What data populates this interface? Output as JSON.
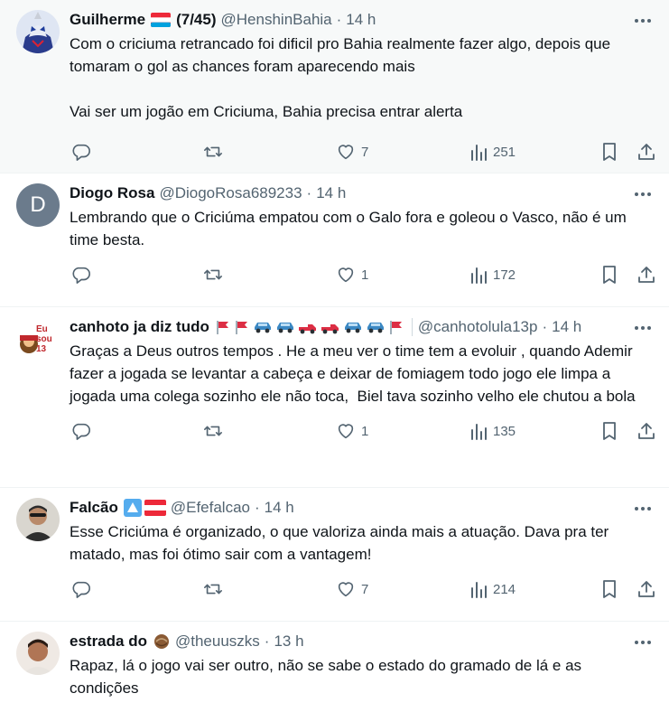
{
  "tweets": [
    {
      "name": "Guilherme",
      "name_suffix": "(7/45)",
      "handle": "@HenshinBahia",
      "time": "14 h",
      "text": "Com o criciuma retrancado foi dificil pro Bahia realmente fazer algo, depois que tomaram o gol as chances foram aparecendo mais\n\nVai ser um jogão em Criciuma, Bahia precisa entrar alerta",
      "likes": "7",
      "views": "251",
      "avatar_icon": "robot-hero-avatar",
      "highlighted": true
    },
    {
      "name": "Diogo Rosa",
      "handle": "@DiogoRosa689233",
      "time": "14 h",
      "text": "Lembrando que o Criciúma empatou com o Galo fora e goleou o Vasco, não é um time besta.",
      "likes": "1",
      "views": "172",
      "avatar_letter": "D",
      "avatar_color": "#5b7083"
    },
    {
      "name": "canhoto ja diz tudo",
      "handle": "@canhotolula13p",
      "time": "14 h",
      "text": "Graças a Deus outros tempos . He a meu ver o time tem a evoluir , quando Ademir fazer a jogada se levantar a cabeça e deixar de fomiagem todo jogo ele limpa a jogada uma colega sozinho ele não toca,  Biel tava sozinho velho ele chutou a bola",
      "likes": "1",
      "views": "135",
      "avatar_text": "Eu sou 13"
    },
    {
      "name": "Falcão",
      "handle": "@Efefalcao",
      "time": "14 h",
      "text": "Esse Criciúma é organizado, o que valoriza ainda mais a atuação. Dava pra ter matado, mas foi ótimo sair com a vantagem!",
      "likes": "7",
      "views": "214"
    },
    {
      "name": "estrada do",
      "handle": "@theuuszks",
      "time": "13 h",
      "text": "Rapaz, lá o jogo vai ser outro, não se sabe o estado do gramado de lá e as condições"
    }
  ],
  "separator": "·",
  "colors": {
    "text": "#0f1419",
    "secondary": "#536471",
    "border": "#eff3f4",
    "highlight_bg": "#f7f9f9"
  }
}
